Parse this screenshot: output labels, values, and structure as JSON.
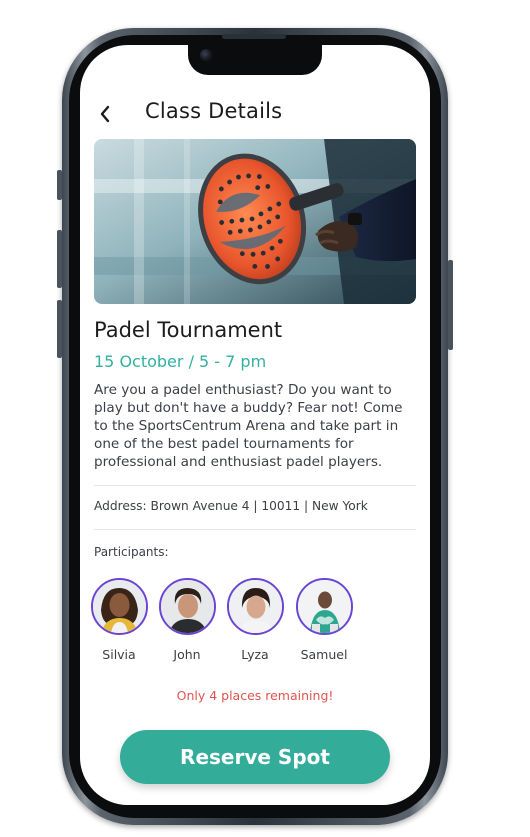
{
  "header": {
    "title": "Class Details",
    "back_icon": "chevron-left-icon"
  },
  "event": {
    "title": "Padel Tournament",
    "date": "15 October / 5 - 7 pm",
    "description": "Are you a padel enthusiast? Do you want to play but don't have a buddy? Fear not! Come to the SportsCentrum Arena and take part in one of the best padel tournaments for professional and enthusiast padel players.",
    "address": "Address: Brown Avenue 4 | 10011 | New York"
  },
  "participants": {
    "label": "Participants:",
    "people": [
      {
        "name": "Silvia"
      },
      {
        "name": "John"
      },
      {
        "name": "Lyza"
      },
      {
        "name": "Samuel"
      }
    ]
  },
  "availability": {
    "message": "Only 4 places remaining!"
  },
  "actions": {
    "reserve_label": "Reserve Spot"
  },
  "colors": {
    "accent": "#33ac9a",
    "date_text": "#33b0a0",
    "warning": "#e2534e",
    "avatar_ring": "#6a45d4"
  }
}
